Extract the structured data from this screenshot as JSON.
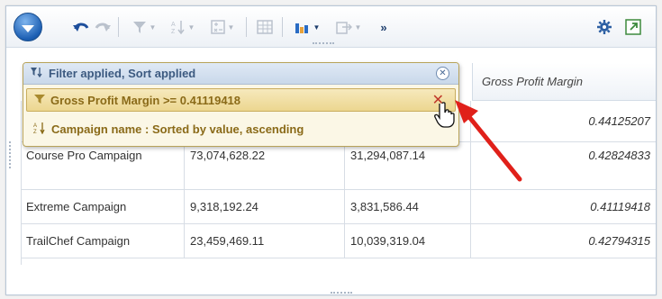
{
  "toolbar": {
    "buttons": [
      {
        "name": "menu-button",
        "icon": "chevron-down-icon"
      },
      {
        "name": "undo-button",
        "icon": "undo-icon"
      },
      {
        "name": "redo-button",
        "icon": "redo-icon"
      },
      {
        "name": "filter-button",
        "icon": "funnel-icon"
      },
      {
        "name": "sort-button",
        "icon": "sort-icon"
      },
      {
        "name": "calculation-button",
        "icon": "calculator-icon"
      },
      {
        "name": "table-button",
        "icon": "table-icon"
      },
      {
        "name": "chart-button",
        "icon": "bar-chart-icon"
      },
      {
        "name": "export-button",
        "icon": "export-icon"
      },
      {
        "name": "more-button",
        "icon": "double-chevron-icon"
      },
      {
        "name": "settings-button",
        "icon": "gear-icon"
      },
      {
        "name": "maximize-button",
        "icon": "maximize-icon"
      }
    ]
  },
  "popup": {
    "title": "Filter applied, Sort applied",
    "filter": "Gross Profit Margin >= 0.41119418",
    "sort": "Campaign name : Sorted by value, ascending"
  },
  "table": {
    "header_gpm": "Gross Profit Margin",
    "rows": [
      {
        "campaign": "",
        "revenue": "",
        "profit": "",
        "margin": "0.44125207"
      },
      {
        "campaign": "Course Pro Campaign",
        "revenue": "73,074,628.22",
        "profit": "31,294,087.14",
        "margin": "0.42824833"
      },
      {
        "campaign": "Extreme Campaign",
        "revenue": "9,318,192.24",
        "profit": "3,831,586.44",
        "margin": "0.41119418"
      },
      {
        "campaign": "TrailChef Campaign",
        "revenue": "23,459,469.11",
        "profit": "10,039,319.04",
        "margin": "0.42794315"
      }
    ]
  },
  "colors": {
    "accent_blue": "#1c5fb3",
    "filter_bg": "#ecd68f",
    "filter_text": "#8a6a18",
    "close_red": "#c0392b",
    "arrow_red": "#e0201a"
  }
}
